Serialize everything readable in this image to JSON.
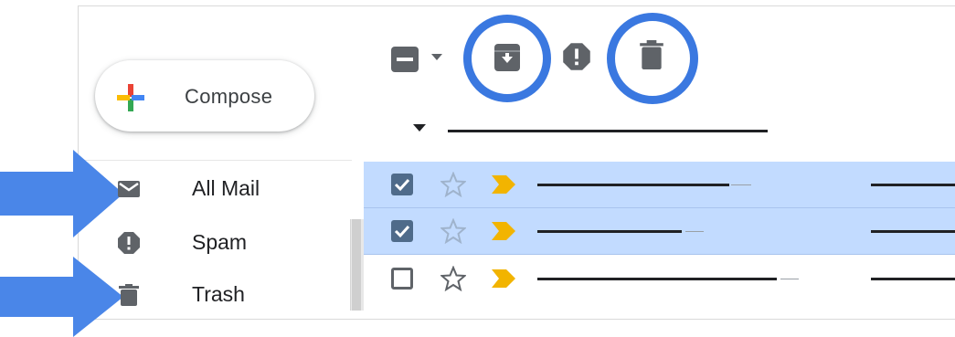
{
  "compose": {
    "label": "Compose",
    "icon": "plus-multicolor-icon"
  },
  "sidebar": {
    "items": [
      {
        "label": "All Mail",
        "icon": "mail-envelope-icon"
      },
      {
        "label": "Spam",
        "icon": "spam-report-icon"
      },
      {
        "label": "Trash",
        "icon": "trash-icon"
      }
    ]
  },
  "toolbar": {
    "select_icon": "select-checkbox-icon",
    "select_menu_icon": "caret-down-icon",
    "archive_icon": "archive-icon",
    "spam_icon": "report-spam-icon",
    "delete_icon": "trash-icon"
  },
  "emails": [
    {
      "selected": true,
      "starred": false,
      "important": true
    },
    {
      "selected": true,
      "starred": false,
      "important": true
    },
    {
      "selected": false,
      "starred": false,
      "important": true
    }
  ],
  "colors": {
    "highlight_blue": "#3a78e0",
    "selected_row": "#c2dbff",
    "important_marker": "#f2b400",
    "icon_gray": "#5f6368"
  }
}
